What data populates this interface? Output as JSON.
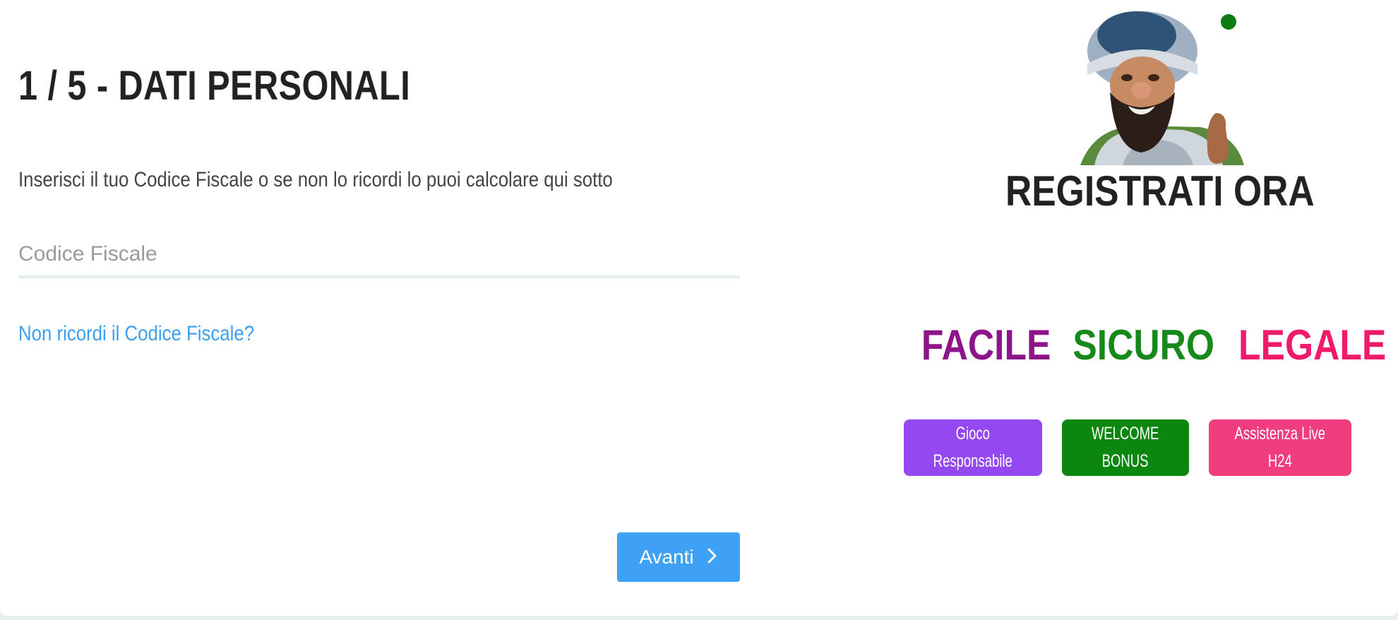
{
  "form": {
    "step_title": "1 / 5 - DATI PERSONALI",
    "instruction": "Inserisci il tuo Codice Fiscale o se non lo ricordi lo puoi calcolare qui sotto",
    "codice_fiscale": {
      "placeholder": "Codice Fiscale",
      "value": ""
    },
    "forgot_link": "Non ricordi il Codice Fiscale?",
    "next_label": "Avanti",
    "next_icon": "chevron-right-icon"
  },
  "promo": {
    "mascot": "bearded-explorer-mascot",
    "status_dot_color": "#0b7d12",
    "title": "REGISTRATI ORA",
    "tagline": [
      {
        "label": "FACILE",
        "color": "#8b1589"
      },
      {
        "label": "SICURO",
        "color": "#15891a"
      },
      {
        "label": "LEGALE",
        "color": "#ef1b6a"
      }
    ],
    "badges": [
      {
        "line1": "Gioco",
        "line2": "Responsabile",
        "color": "#9448f0"
      },
      {
        "line1": "WELCOME",
        "line2": "BONUS",
        "color": "#0b870f"
      },
      {
        "line1": "Assistenza Live",
        "line2": "H24",
        "color": "#ef3d7e"
      }
    ]
  },
  "colors": {
    "link": "#3a9ff2",
    "primary_button": "#3fa1f5",
    "text": "#222222"
  }
}
